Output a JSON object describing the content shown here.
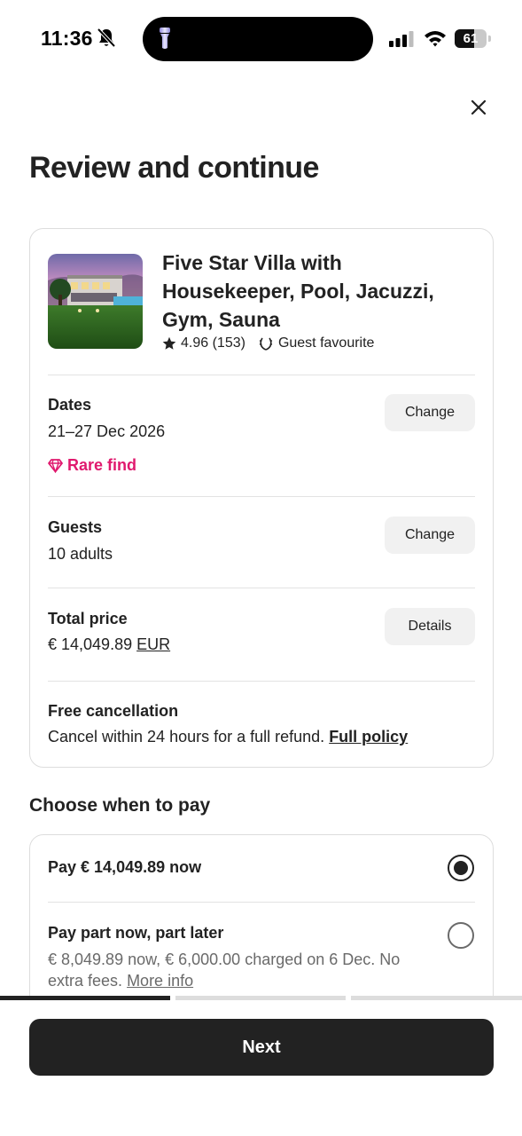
{
  "status_bar": {
    "time": "11:36",
    "battery_percent": "61",
    "battery_level": 0.61
  },
  "header": {
    "title": "Review and continue"
  },
  "listing": {
    "title": "Five Star Villa with Housekeeper, Pool, Jacuzzi, Gym, Sauna",
    "rating": "4.96 (153)",
    "badge": "Guest favourite"
  },
  "dates": {
    "label": "Dates",
    "value": "21–27 Dec 2026",
    "button": "Change",
    "rare_find": "Rare find"
  },
  "guests": {
    "label": "Guests",
    "value": "10 adults",
    "button": "Change"
  },
  "price": {
    "label": "Total price",
    "amount": "€ 14,049.89",
    "currency": "EUR",
    "button": "Details"
  },
  "cancellation": {
    "label": "Free cancellation",
    "text": "Cancel within 24 hours for a full refund.",
    "link": "Full policy"
  },
  "payment": {
    "section_title": "Choose when to pay",
    "options": [
      {
        "label": "Pay € 14,049.89 now",
        "selected": true
      },
      {
        "label": "Pay part now, part later",
        "sub": "€ 8,049.89 now, € 6,000.00 charged on 6 Dec. No extra fees.",
        "link": "More info",
        "selected": false
      }
    ]
  },
  "footer": {
    "next_label": "Next",
    "progress_step": 1,
    "progress_total": 3
  },
  "colors": {
    "text": "#222222",
    "muted": "#6a6a6a",
    "accent": "#e0196e",
    "button_bg": "#f1f1f1",
    "primary": "#222222"
  },
  "icons": [
    "bell-slash-icon",
    "flashlight-icon",
    "signal-icon",
    "wifi-icon",
    "battery-icon",
    "close-icon",
    "star-icon",
    "laurel-icon",
    "diamond-icon"
  ]
}
